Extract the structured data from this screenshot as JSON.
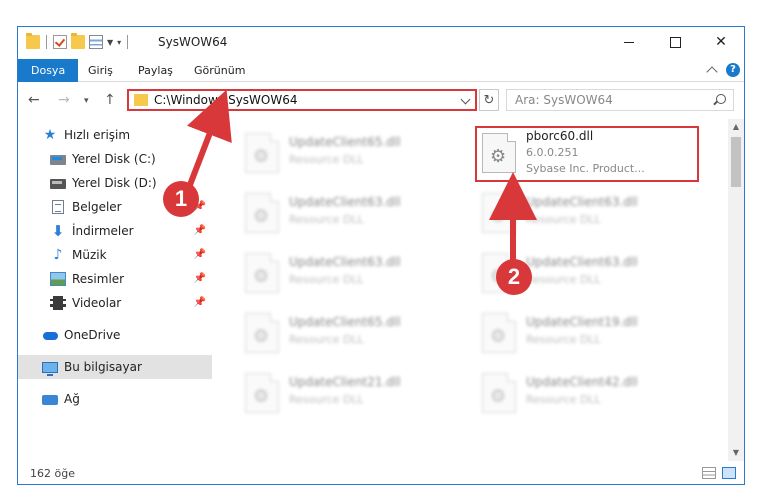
{
  "window": {
    "title": "SysWOW64"
  },
  "ribbon": {
    "tabs": [
      {
        "label": "Dosya",
        "active": true
      },
      {
        "label": "Giriş",
        "active": false
      },
      {
        "label": "Paylaş",
        "active": false
      },
      {
        "label": "Görünüm",
        "active": false
      }
    ],
    "help_label": "?"
  },
  "address": {
    "path": "C:\\Windows\\SysWOW64",
    "search_placeholder": "Ara: SysWOW64"
  },
  "sidebar": {
    "items": [
      {
        "label": "Hızlı erişim",
        "icon": "star-icon",
        "pinned": false
      },
      {
        "label": "Yerel Disk (C:)",
        "icon": "drive-c-icon",
        "pinned": false
      },
      {
        "label": "Yerel Disk (D:)",
        "icon": "drive-d-icon",
        "pinned": false
      },
      {
        "label": "Belgeler",
        "icon": "documents-icon",
        "pinned": true
      },
      {
        "label": "İndirmeler",
        "icon": "downloads-icon",
        "pinned": true
      },
      {
        "label": "Müzik",
        "icon": "music-icon",
        "pinned": true
      },
      {
        "label": "Resimler",
        "icon": "pictures-icon",
        "pinned": true
      },
      {
        "label": "Videolar",
        "icon": "videos-icon",
        "pinned": true
      },
      {
        "label": "OneDrive",
        "icon": "onedrive-icon",
        "pinned": false
      },
      {
        "label": "Bu bilgisayar",
        "icon": "this-pc-icon",
        "pinned": false,
        "selected": true
      },
      {
        "label": "Ağ",
        "icon": "network-icon",
        "pinned": false
      }
    ]
  },
  "files": {
    "left_column": [
      {
        "name": "UpdateClient65.dll",
        "type": "Resource DLL"
      },
      {
        "name": "UpdateClient63.dll",
        "type": "Resource DLL"
      },
      {
        "name": "UpdateClient63.dll",
        "type": "Resource DLL"
      },
      {
        "name": "UpdateClient65.dll",
        "type": "Resource DLL"
      },
      {
        "name": "UpdateClient21.dll",
        "type": "Resource DLL"
      }
    ],
    "highlighted": {
      "name": "pborc60.dll",
      "version": "6.0.0.251",
      "company": "Sybase Inc. Product..."
    },
    "right_column": [
      {
        "name": "UpdateClient63.dll",
        "type": "Resource DLL"
      },
      {
        "name": "UpdateClient63.dll",
        "type": "Resource DLL"
      },
      {
        "name": "UpdateClient19.dll",
        "type": "Resource DLL"
      },
      {
        "name": "UpdateClient42.dll",
        "type": "Resource DLL"
      }
    ]
  },
  "status": {
    "item_count": "162 öğe"
  },
  "annotations": {
    "step1": "1",
    "step2": "2",
    "color": "#d9383a"
  }
}
